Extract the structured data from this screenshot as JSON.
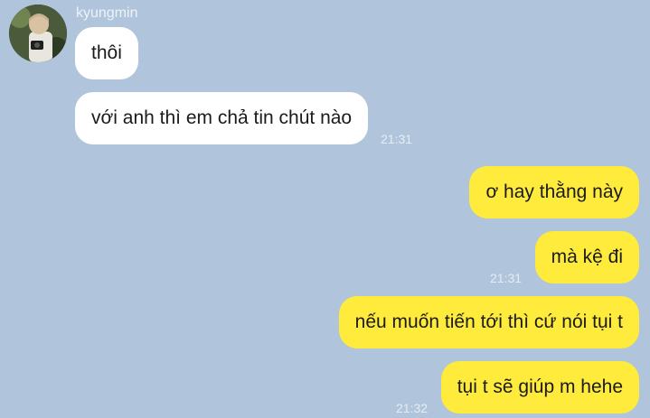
{
  "chat": {
    "sender_name": "kyungmin",
    "incoming": [
      {
        "text": "thôi"
      },
      {
        "text": "với anh thì em chả tin chút nào"
      }
    ],
    "incoming_time": "21:31",
    "outgoing": [
      {
        "text": "ơ hay thằng này"
      },
      {
        "text": "mà kệ đi"
      },
      {
        "text": "nếu muốn tiến tới thì cứ nói tụi t"
      },
      {
        "text": "tụi t sẽ giúp m hehe"
      }
    ],
    "outgoing_times": [
      "21:31",
      "21:32"
    ]
  },
  "colors": {
    "background": "#b0c4dc",
    "incoming_bubble": "#ffffff",
    "outgoing_bubble": "#ffeb3b"
  },
  "icons": {
    "avatar": "profile-photo-avatar"
  }
}
